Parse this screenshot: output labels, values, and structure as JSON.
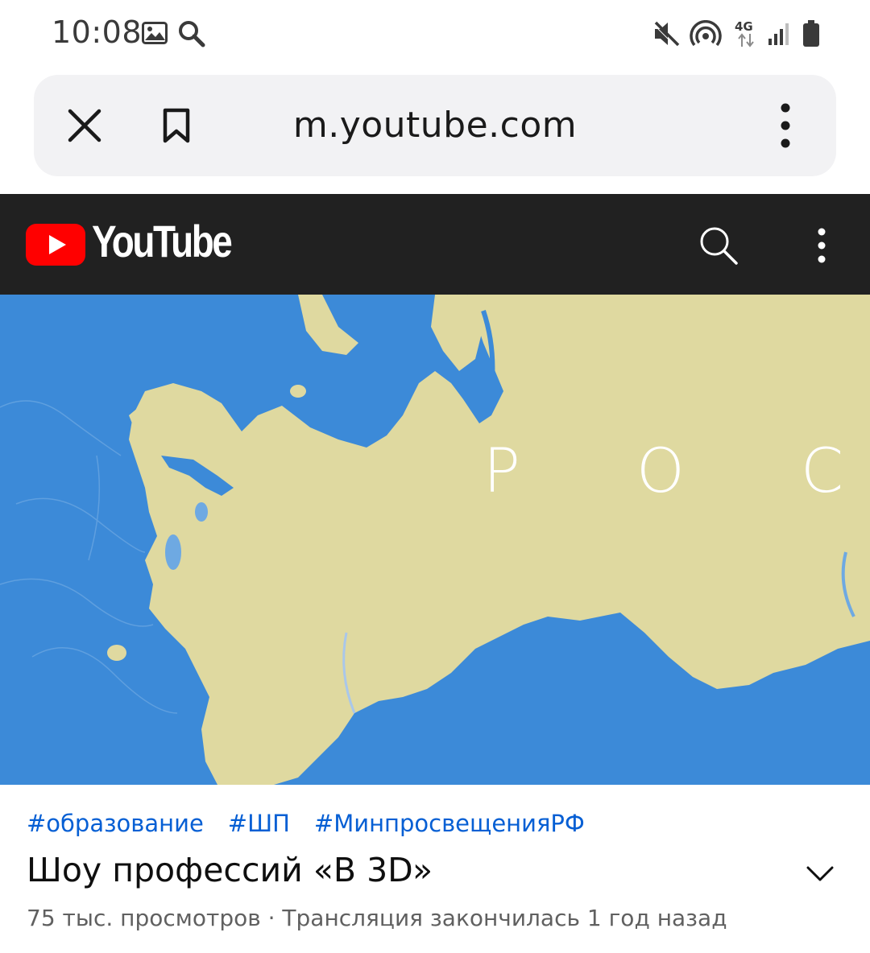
{
  "status_bar": {
    "time": "10:08",
    "network_type": "4G",
    "left_icons": [
      "image-icon",
      "search-icon"
    ],
    "right_icons": [
      "mute-icon",
      "hotspot-icon",
      "network-4g-icon",
      "signal-icon",
      "battery-icon"
    ]
  },
  "browser": {
    "url": "m.youtube.com",
    "close_icon": "close-icon",
    "bookmark_icon": "bookmark-icon",
    "menu_icon": "more-vert-icon"
  },
  "youtube_header": {
    "wordmark": "YouTube",
    "brand_color": "#ff0000",
    "header_color": "#212121"
  },
  "player": {
    "overlay_text": "Р О С С"
  },
  "video": {
    "hashtags": [
      "#образование",
      "#ШП",
      "#МинпросвещенияРФ"
    ],
    "title": "Шоу профессий «В 3D»",
    "meta": "75 тыс. просмотров · Трансляция закончилась 1 год назад"
  },
  "colors": {
    "hashtag": "#065fd4",
    "meta": "#606060",
    "map_sea": "#3c8ad8",
    "map_land": "#dfd9a0"
  }
}
